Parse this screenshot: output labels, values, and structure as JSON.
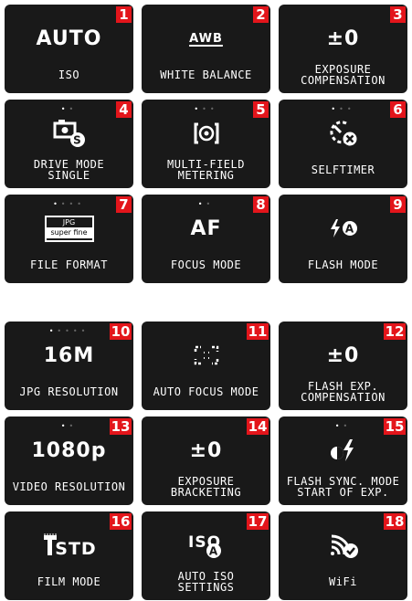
{
  "tiles": [
    {
      "number": "1",
      "value": "AUTO",
      "label": "ISO",
      "icon": "",
      "dots_total": 0,
      "dots_active": 0
    },
    {
      "number": "2",
      "value": "AWB",
      "label": "WHITE BALANCE",
      "icon": "",
      "dots_total": 0,
      "dots_active": 0
    },
    {
      "number": "3",
      "value": "±0",
      "label": "EXPOSURE\nCOMPENSATION",
      "icon": "",
      "dots_total": 0,
      "dots_active": 0
    },
    {
      "number": "4",
      "value": "",
      "label": "DRIVE MODE\nSINGLE",
      "icon": "drive-mode-single-icon",
      "dots_total": 2,
      "dots_active": 1
    },
    {
      "number": "5",
      "value": "",
      "label": "MULTI-FIELD\nMETERING",
      "icon": "multi-field-metering-icon",
      "dots_total": 3,
      "dots_active": 1
    },
    {
      "number": "6",
      "value": "",
      "label": "SELFTIMER",
      "icon": "selftimer-off-icon",
      "dots_total": 3,
      "dots_active": 1
    },
    {
      "number": "7",
      "value": "",
      "label": "FILE FORMAT",
      "icon": "jpg-superfine-icon",
      "icon_text_top": "JPG",
      "icon_text_bottom": "super fine",
      "dots_total": 4,
      "dots_active": 1
    },
    {
      "number": "8",
      "value": "AF",
      "label": "FOCUS MODE",
      "icon": "",
      "dots_total": 2,
      "dots_active": 1
    },
    {
      "number": "9",
      "value": "",
      "label": "FLASH MODE",
      "icon": "flash-auto-icon",
      "icon_letter": "A",
      "dots_total": 0,
      "dots_active": 0
    },
    {
      "number": "10",
      "value": "16M",
      "label": "JPG RESOLUTION",
      "icon": "",
      "dots_total": 5,
      "dots_active": 1
    },
    {
      "number": "11",
      "value": "",
      "label": "AUTO FOCUS MODE",
      "icon": "autofocus-field-icon",
      "dots_total": 0,
      "dots_active": 0
    },
    {
      "number": "12",
      "value": "±0",
      "label": "FLASH EXP.\nCOMPENSATION",
      "icon": "",
      "dots_total": 0,
      "dots_active": 0
    },
    {
      "number": "13",
      "value": "1080p",
      "label": "VIDEO RESOLUTION",
      "icon": "",
      "dots_total": 2,
      "dots_active": 1
    },
    {
      "number": "14",
      "value": "±0",
      "label": "EXPOSURE\nBRACKETING",
      "icon": "",
      "dots_total": 0,
      "dots_active": 0
    },
    {
      "number": "15",
      "value": "",
      "label": "FLASH SYNC. MODE\nSTART OF EXP.",
      "icon": "flash-sync-start-icon",
      "dots_total": 2,
      "dots_active": 1
    },
    {
      "number": "16",
      "value": "",
      "label": "FILM MODE",
      "icon": "film-mode-std-icon",
      "icon_text": "STD",
      "dots_total": 0,
      "dots_active": 0
    },
    {
      "number": "17",
      "value": "",
      "label": "AUTO ISO\nSETTINGS",
      "icon": "auto-iso-icon",
      "icon_text": "ISO",
      "icon_letter": "A",
      "dots_total": 0,
      "dots_active": 0
    },
    {
      "number": "18",
      "value": "",
      "label": "WiFi",
      "icon": "wifi-connected-icon",
      "dots_total": 0,
      "dots_active": 0
    }
  ]
}
